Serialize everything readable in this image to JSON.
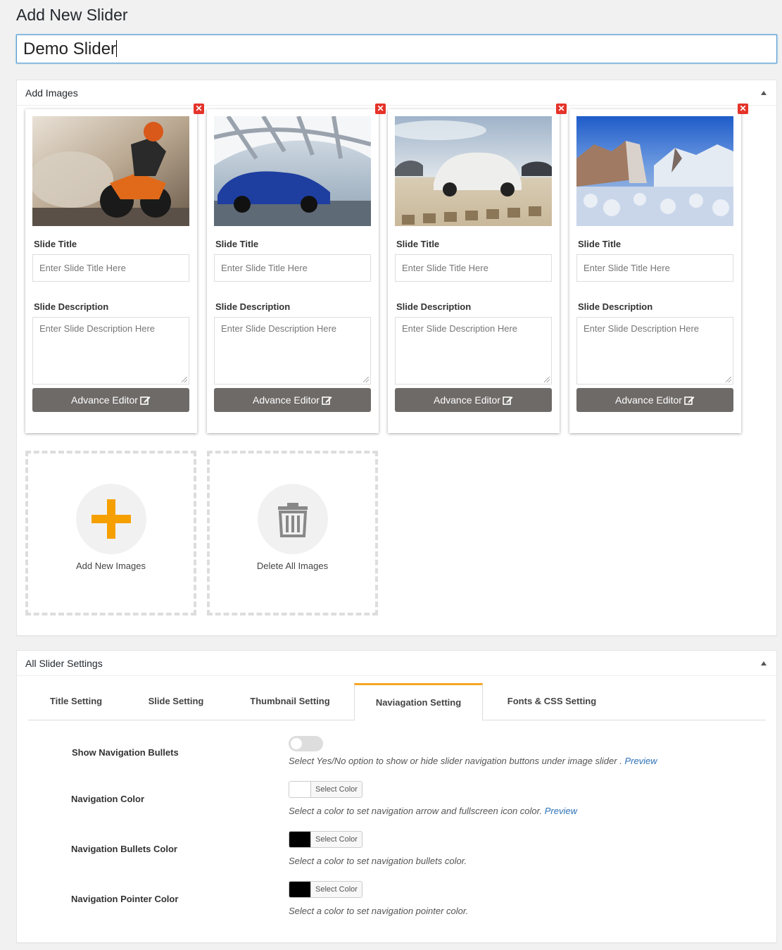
{
  "page": {
    "title": "Add New Slider",
    "slider_name": "Demo Slider"
  },
  "images_box": {
    "header": "Add Images",
    "slides": [
      {
        "image": "motorcycle-photo",
        "remove_icon": "close-icon",
        "title_label": "Slide Title",
        "title_placeholder": "Enter Slide Title Here",
        "desc_label": "Slide Description",
        "desc_placeholder": "Enter Slide Description Here",
        "button_label": "Advance Editor"
      },
      {
        "image": "blue-car-photo",
        "remove_icon": "close-icon",
        "title_label": "Slide Title",
        "title_placeholder": "Enter Slide Title Here",
        "desc_label": "Slide Description",
        "desc_placeholder": "Enter Slide Description Here",
        "button_label": "Advance Editor"
      },
      {
        "image": "white-suv-photo",
        "remove_icon": "close-icon",
        "title_label": "Slide Title",
        "title_placeholder": "Enter Slide Title Here",
        "desc_label": "Slide Description",
        "desc_placeholder": "Enter Slide Description Here",
        "button_label": "Advance Editor"
      },
      {
        "image": "snowy-valley-photo",
        "remove_icon": "close-icon",
        "title_label": "Slide Title",
        "title_placeholder": "Enter Slide Title Here",
        "desc_label": "Slide Description",
        "desc_placeholder": "Enter Slide Description Here",
        "button_label": "Advance Editor"
      }
    ],
    "add_label": "Add New Images",
    "delete_label": "Delete All Images"
  },
  "settings_box": {
    "header": "All Slider Settings",
    "tabs": [
      {
        "label": "Title Setting"
      },
      {
        "label": "Slide Setting"
      },
      {
        "label": "Thumbnail Setting"
      },
      {
        "label": "Naviagation Setting",
        "active": true
      },
      {
        "label": "Fonts & CSS Setting"
      }
    ],
    "rows": {
      "bullets": {
        "label": "Show Navigation Bullets",
        "desc": "Select Yes/No option to show or hide slider navigation buttons under image slider . ",
        "link": "Preview",
        "enabled": false
      },
      "nav_color": {
        "label": "Navigation Color",
        "desc": "Select a color to set navigation arrow and fullscreen icon color. ",
        "link": "Preview",
        "button": "Select Color",
        "color": "#ffffff"
      },
      "bullets_color": {
        "label": "Navigation Bullets Color",
        "desc": "Select a color to set navigation bullets color.",
        "button": "Select Color",
        "color": "#000000"
      },
      "pointer_color": {
        "label": "Navigation Pointer Color",
        "desc": "Select a color to set navigation pointer color.",
        "button": "Select Color",
        "color": "#000000"
      }
    }
  },
  "colors": {
    "accent": "#f5a623",
    "remove": "#e5332a",
    "button": "#6d6a68",
    "link": "#2e73b8"
  }
}
